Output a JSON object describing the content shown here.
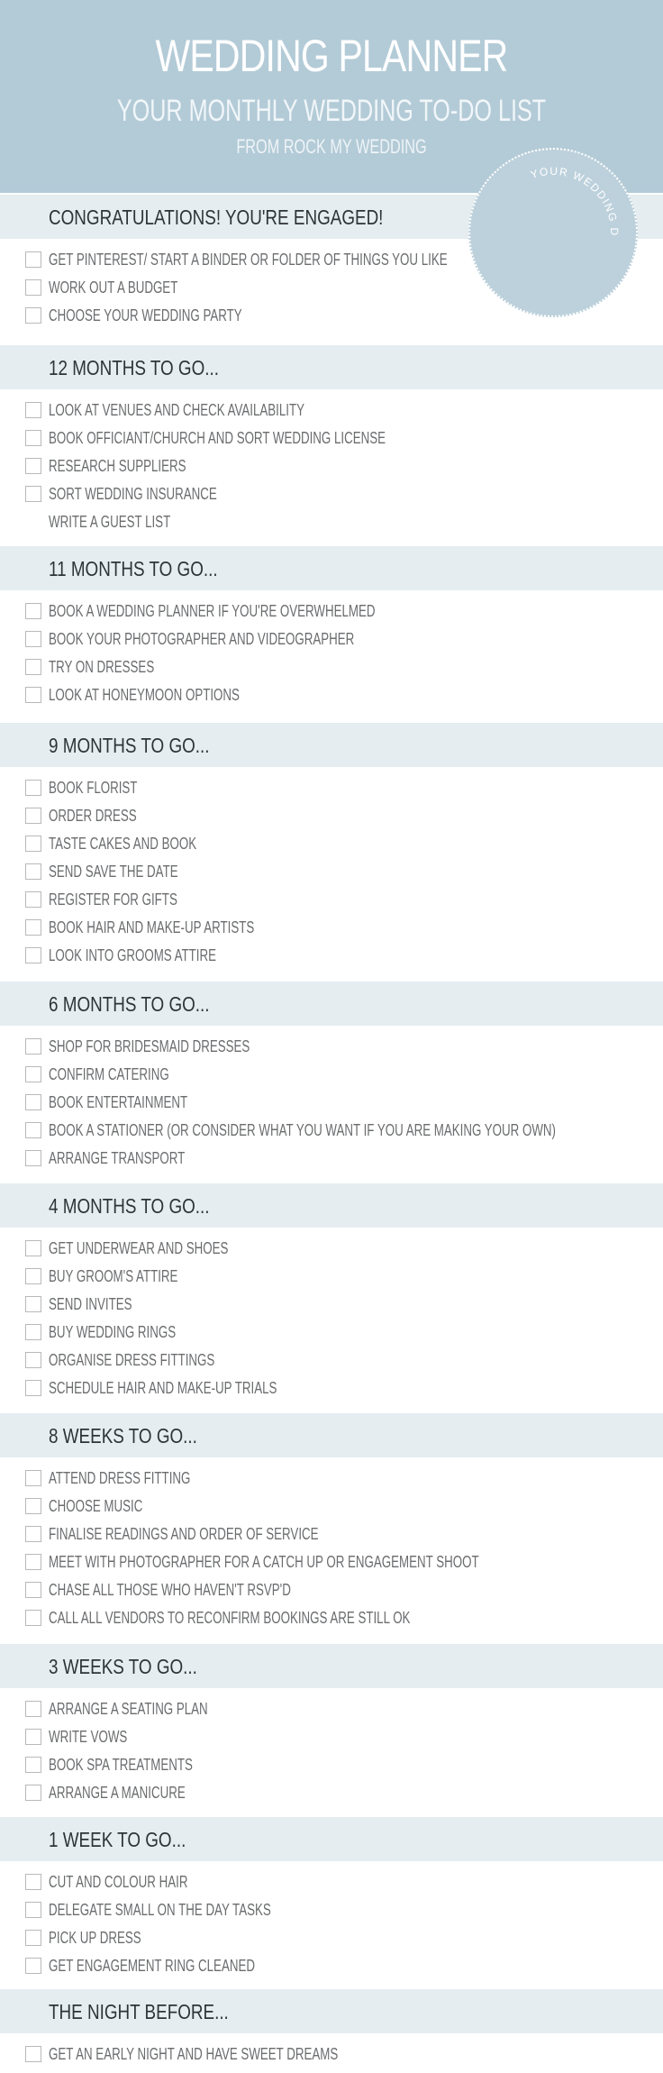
{
  "header": {
    "title": "WEDDING PLANNER",
    "subtitle": "YOUR MONTHLY WEDDING TO-DO LIST",
    "byline": "FROM ROCK MY WEDDING",
    "background_color": "#b3cbd7"
  },
  "date_badge": {
    "label": "YOUR WEDDING DATE",
    "color": "#bdd1dc"
  },
  "sections": [
    {
      "title": "CONGRATULATIONS! YOU'RE ENGAGED!",
      "items": [
        {
          "label": "GET PINTEREST/ START A BINDER OR FOLDER OF THINGS YOU LIKE",
          "checkbox": true,
          "checked": false
        },
        {
          "label": "WORK OUT A BUDGET",
          "checkbox": true,
          "checked": false
        },
        {
          "label": "CHOOSE YOUR WEDDING PARTY",
          "checkbox": true,
          "checked": false
        }
      ]
    },
    {
      "title": "12 MONTHS TO GO...",
      "items": [
        {
          "label": "LOOK AT VENUES AND CHECK AVAILABILITY",
          "checkbox": true,
          "checked": false
        },
        {
          "label": "BOOK OFFICIANT/CHURCH AND SORT WEDDING LICENSE",
          "checkbox": true,
          "checked": false
        },
        {
          "label": "RESEARCH SUPPLIERS",
          "checkbox": true,
          "checked": false
        },
        {
          "label": "SORT WEDDING INSURANCE",
          "checkbox": true,
          "checked": false
        },
        {
          "label": "WRITE A GUEST LIST",
          "checkbox": false,
          "checked": false
        }
      ]
    },
    {
      "title": "11 MONTHS TO GO...",
      "items": [
        {
          "label": "BOOK A WEDDING PLANNER IF YOU'RE OVERWHELMED",
          "checkbox": true,
          "checked": false
        },
        {
          "label": "BOOK YOUR PHOTOGRAPHER AND VIDEOGRAPHER",
          "checkbox": true,
          "checked": false
        },
        {
          "label": "TRY ON DRESSES",
          "checkbox": true,
          "checked": false
        },
        {
          "label": "LOOK AT HONEYMOON OPTIONS",
          "checkbox": true,
          "checked": false
        }
      ]
    },
    {
      "title": "9 MONTHS TO GO...",
      "items": [
        {
          "label": "BOOK FLORIST",
          "checkbox": true,
          "checked": false
        },
        {
          "label": "ORDER DRESS",
          "checkbox": true,
          "checked": false
        },
        {
          "label": "TASTE CAKES AND BOOK",
          "checkbox": true,
          "checked": false
        },
        {
          "label": "SEND SAVE THE DATE",
          "checkbox": true,
          "checked": false
        },
        {
          "label": "REGISTER FOR GIFTS",
          "checkbox": true,
          "checked": false
        },
        {
          "label": "BOOK HAIR AND MAKE-UP ARTISTS",
          "checkbox": true,
          "checked": false
        },
        {
          "label": "LOOK INTO GROOMS ATTIRE",
          "checkbox": true,
          "checked": false
        }
      ]
    },
    {
      "title": "6 MONTHS TO GO...",
      "items": [
        {
          "label": "SHOP FOR BRIDESMAID DRESSES",
          "checkbox": true,
          "checked": false
        },
        {
          "label": "CONFIRM CATERING",
          "checkbox": true,
          "checked": false
        },
        {
          "label": "BOOK ENTERTAINMENT",
          "checkbox": true,
          "checked": false
        },
        {
          "label": "BOOK A STATIONER (OR CONSIDER WHAT YOU WANT IF YOU ARE MAKING YOUR OWN)",
          "checkbox": true,
          "checked": false
        },
        {
          "label": "ARRANGE TRANSPORT",
          "checkbox": true,
          "checked": false
        }
      ]
    },
    {
      "title": "4 MONTHS TO GO...",
      "items": [
        {
          "label": "GET UNDERWEAR AND SHOES",
          "checkbox": true,
          "checked": false
        },
        {
          "label": "BUY GROOM'S ATTIRE",
          "checkbox": true,
          "checked": false
        },
        {
          "label": "SEND INVITES",
          "checkbox": true,
          "checked": false
        },
        {
          "label": "BUY WEDDING RINGS",
          "checkbox": true,
          "checked": false
        },
        {
          "label": "ORGANISE DRESS FITTINGS",
          "checkbox": true,
          "checked": false
        },
        {
          "label": "SCHEDULE HAIR AND MAKE-UP TRIALS",
          "checkbox": true,
          "checked": false
        }
      ]
    },
    {
      "title": "8 WEEKS TO GO...",
      "items": [
        {
          "label": "ATTEND DRESS FITTING",
          "checkbox": true,
          "checked": false
        },
        {
          "label": "CHOOSE MUSIC",
          "checkbox": true,
          "checked": false
        },
        {
          "label": "FINALISE READINGS AND ORDER OF SERVICE",
          "checkbox": true,
          "checked": false
        },
        {
          "label": "MEET WITH PHOTOGRAPHER FOR A CATCH UP OR ENGAGEMENT SHOOT",
          "checkbox": true,
          "checked": false
        },
        {
          "label": "CHASE ALL THOSE WHO HAVEN'T RSVP'D",
          "checkbox": true,
          "checked": false
        },
        {
          "label": "CALL ALL VENDORS TO RECONFIRM BOOKINGS ARE STILL OK",
          "checkbox": true,
          "checked": false
        }
      ]
    },
    {
      "title": "3 WEEKS TO GO...",
      "items": [
        {
          "label": "ARRANGE A SEATING PLAN",
          "checkbox": true,
          "checked": false
        },
        {
          "label": "WRITE VOWS",
          "checkbox": true,
          "checked": false
        },
        {
          "label": "BOOK SPA TREATMENTS",
          "checkbox": true,
          "checked": false
        },
        {
          "label": "ARRANGE A MANICURE",
          "checkbox": true,
          "checked": false
        }
      ]
    },
    {
      "title": "1 WEEK TO GO...",
      "items": [
        {
          "label": "CUT AND COLOUR HAIR",
          "checkbox": true,
          "checked": false
        },
        {
          "label": "DELEGATE SMALL ON THE DAY TASKS",
          "checkbox": true,
          "checked": false
        },
        {
          "label": "PICK UP DRESS",
          "checkbox": true,
          "checked": false
        },
        {
          "label": "GET ENGAGEMENT RING CLEANED",
          "checkbox": true,
          "checked": false
        }
      ]
    },
    {
      "title": "THE NIGHT BEFORE...",
      "items": [
        {
          "label": "GET AN EARLY NIGHT AND HAVE SWEET DREAMS",
          "checkbox": true,
          "checked": false
        }
      ]
    }
  ]
}
